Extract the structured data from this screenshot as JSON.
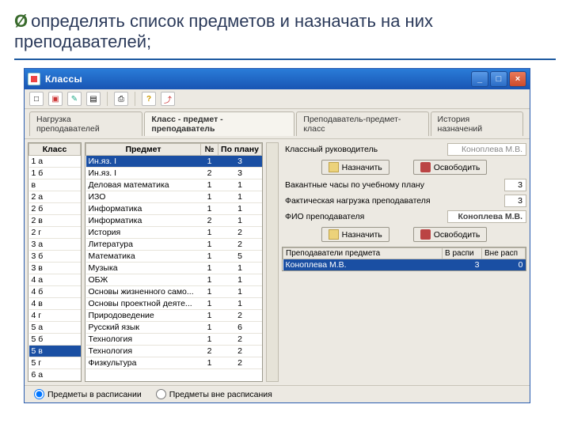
{
  "slide": {
    "bullet": "определять список предметов и назначать на них преподавателей;"
  },
  "window": {
    "title": "Классы",
    "buttons": {
      "min": "_",
      "max": "□",
      "close": "×"
    }
  },
  "tabs": [
    "Нагрузка преподавателей",
    "Класс - предмет - преподаватель",
    "Преподаватель-предмет-класс",
    "История назначений"
  ],
  "cols": {
    "class": "Класс",
    "subject": "Предмет",
    "num": "№",
    "plan": "По плану"
  },
  "classes": [
    "1 а",
    "1 б",
    "в",
    "2 а",
    "2 б",
    "2 в",
    "2 г",
    "3 а",
    "3 б",
    "3 в",
    "4 а",
    "4 б",
    "4 в",
    "4 г",
    "5 а",
    "5 б",
    "5 в",
    "5 г",
    "6 а"
  ],
  "classSel": 16,
  "subjects": [
    [
      "Ин.яз. I",
      "1",
      "3"
    ],
    [
      "Ин.яз. I",
      "2",
      "3"
    ],
    [
      "Деловая математика",
      "1",
      "1"
    ],
    [
      "ИЗО",
      "1",
      "1"
    ],
    [
      "Информатика",
      "1",
      "1"
    ],
    [
      "Информатика",
      "2",
      "1"
    ],
    [
      "История",
      "1",
      "2"
    ],
    [
      "Литература",
      "1",
      "2"
    ],
    [
      "Математика",
      "1",
      "5"
    ],
    [
      "Музыка",
      "1",
      "1"
    ],
    [
      "ОБЖ",
      "1",
      "1"
    ],
    [
      "Основы жизненного само...",
      "1",
      "1"
    ],
    [
      "Основы проектной деяте...",
      "1",
      "1"
    ],
    [
      "Природоведение",
      "1",
      "2"
    ],
    [
      "Русский язык",
      "1",
      "6"
    ],
    [
      "Технология",
      "1",
      "2"
    ],
    [
      "Технология",
      "2",
      "2"
    ],
    [
      "Физкультура",
      "1",
      "2"
    ]
  ],
  "subjSel": 0,
  "right": {
    "teacherLabel": "Классный руководитель",
    "teacherVal": "Коноплева М.В.",
    "assign": "Назначить",
    "free": "Освободить",
    "vacLabel": "Вакантные часы по учебному плану",
    "vacVal": "3",
    "loadLabel": "Фактическая нагрузка преподавателя",
    "loadVal": "3",
    "fioLabel": "ФИО преподавателя",
    "fioVal": "Коноплева М.В.",
    "th": {
      "t": "Преподаватели предмета",
      "r1": "В распи",
      "r2": "Вне расп"
    },
    "row": {
      "name": "Коноплева М.В.",
      "r1": "3",
      "r2": "0"
    }
  },
  "footer": {
    "r1": "Предметы в расписании",
    "r2": "Предметы вне расписания"
  }
}
